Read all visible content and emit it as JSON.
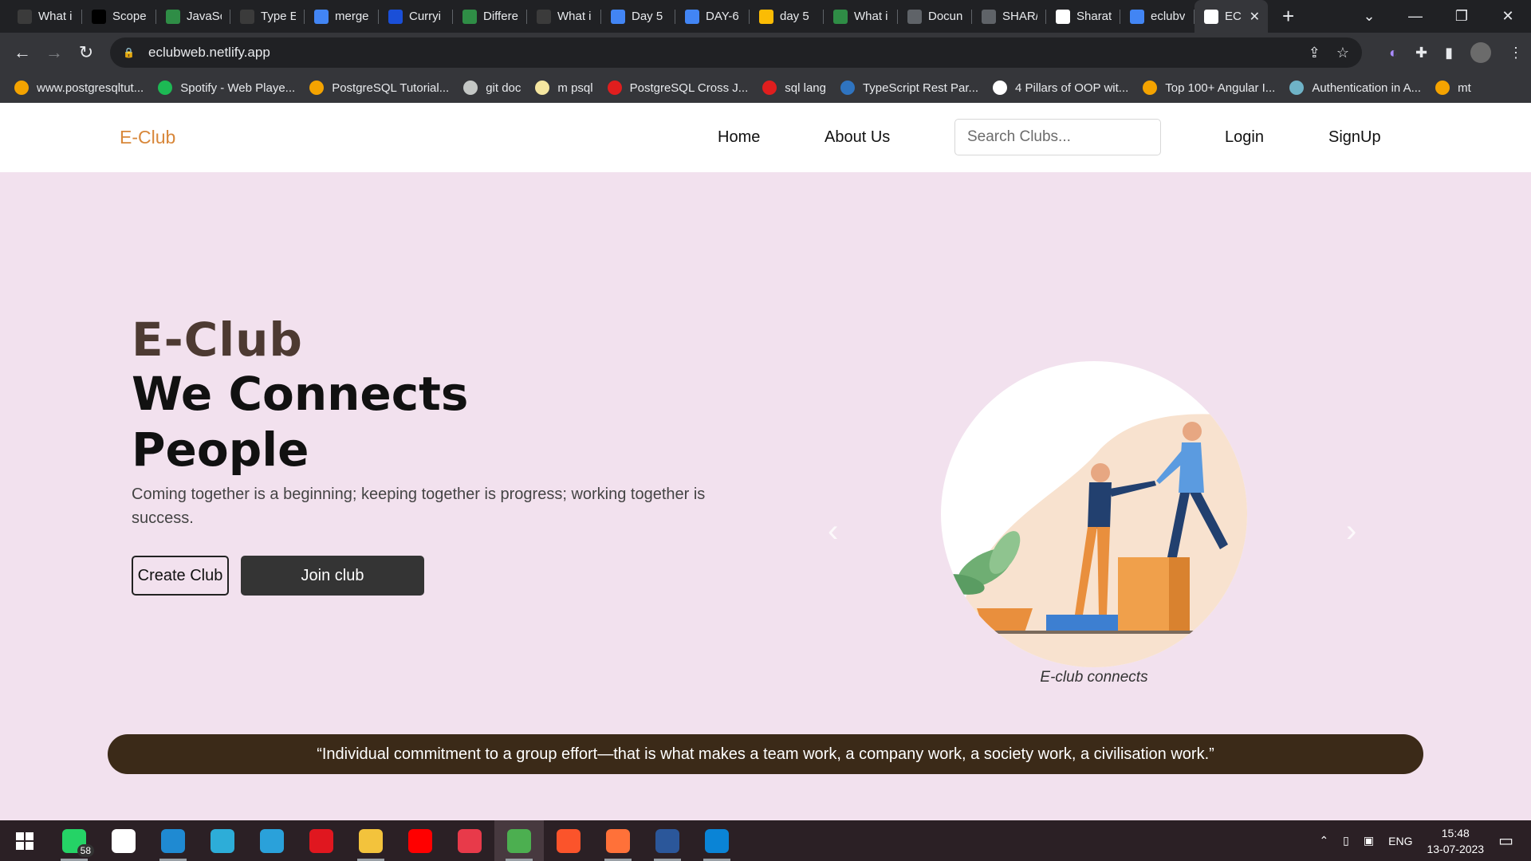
{
  "browser": {
    "tabs": [
      {
        "title": "What i",
        "color": "#3b3b3b"
      },
      {
        "title": "Scope",
        "color": "#000000"
      },
      {
        "title": "JavaSc",
        "color": "#2f8d46"
      },
      {
        "title": "Type E",
        "color": "#3b3b3b"
      },
      {
        "title": "merge",
        "color": "#4285f4"
      },
      {
        "title": "Curryi",
        "color": "#1a4fd8"
      },
      {
        "title": "Differe",
        "color": "#2f8d46"
      },
      {
        "title": "What i",
        "color": "#3b3b3b"
      },
      {
        "title": "Day 5",
        "color": "#4285f4"
      },
      {
        "title": "DAY-6",
        "color": "#4285f4"
      },
      {
        "title": "day 5",
        "color": "#fbbc04"
      },
      {
        "title": "What i",
        "color": "#2f8d46"
      },
      {
        "title": "Docun",
        "color": "#5f6368"
      },
      {
        "title": "SHAR/",
        "color": "#5f6368"
      },
      {
        "title": "Sharat",
        "color": "#ffffff"
      },
      {
        "title": "eclubv",
        "color": "#4285f4"
      },
      {
        "title": "EC",
        "color": "#ffffff"
      }
    ],
    "new_tab_symbol": "+",
    "address": "eclubweb.netlify.app",
    "bookmarks": [
      {
        "label": "www.postgresqltut...",
        "color": "#f4a300"
      },
      {
        "label": "Spotify - Web Playe...",
        "color": "#1db954"
      },
      {
        "label": "PostgreSQL Tutorial...",
        "color": "#f4a300"
      },
      {
        "label": "git doc",
        "color": "#c4c7c5"
      },
      {
        "label": "m psql",
        "color": "#f5e6a0"
      },
      {
        "label": "PostgreSQL Cross J...",
        "color": "#e01e1e"
      },
      {
        "label": "sql lang",
        "color": "#e01e1e"
      },
      {
        "label": "TypeScript Rest Par...",
        "color": "#2f74c0"
      },
      {
        "label": "4 Pillars of OOP wit...",
        "color": "#ffffff"
      },
      {
        "label": "Top 100+ Angular I...",
        "color": "#f4a300"
      },
      {
        "label": "Authentication in A...",
        "color": "#6fb3c7"
      },
      {
        "label": "mt",
        "color": "#f4a300"
      }
    ]
  },
  "site": {
    "brand": "E-Club",
    "nav": {
      "home": "Home",
      "about": "About Us",
      "login": "Login",
      "signup": "SignUp"
    },
    "search_placeholder": "Search Clubs...",
    "hero": {
      "brand": "E-Club",
      "title": "We Connects People",
      "subtitle": "Coming together is a beginning; keeping together is progress; working together is success.",
      "create_button": "Create Club",
      "join_button": "Join club"
    },
    "carousel": {
      "caption": "E-club connects",
      "prev": "‹",
      "next": "›"
    },
    "quote": "“Individual commitment to a group effort—that is what makes a team work, a company work, a society work, a civilisation work.”",
    "colors": {
      "brand": "#d8873a",
      "page_bg": "#f2e1ee",
      "quote_bg": "#3b2a18",
      "join_bg": "#343434"
    }
  },
  "taskbar": {
    "apps": [
      {
        "name": "whatsapp",
        "color": "#25d366",
        "badge": "58"
      },
      {
        "name": "mongodb",
        "color": "#ffffff"
      },
      {
        "name": "vscode",
        "color": "#1f8ad2"
      },
      {
        "name": "edge",
        "color": "#2dadd8"
      },
      {
        "name": "telegram",
        "color": "#2aa1da"
      },
      {
        "name": "opera",
        "color": "#e0171f"
      },
      {
        "name": "file-explorer",
        "color": "#f3c33c"
      },
      {
        "name": "youtube",
        "color": "#ff0000"
      },
      {
        "name": "music",
        "color": "#e83a4a"
      },
      {
        "name": "chrome",
        "color": "#4caf50"
      },
      {
        "name": "brave",
        "color": "#fb542b"
      },
      {
        "name": "firefox",
        "color": "#ff7139"
      },
      {
        "name": "word",
        "color": "#2b579a"
      },
      {
        "name": "mail",
        "color": "#0a84d6"
      }
    ],
    "language": "ENG",
    "time": "15:48",
    "date": "13-07-2023"
  }
}
